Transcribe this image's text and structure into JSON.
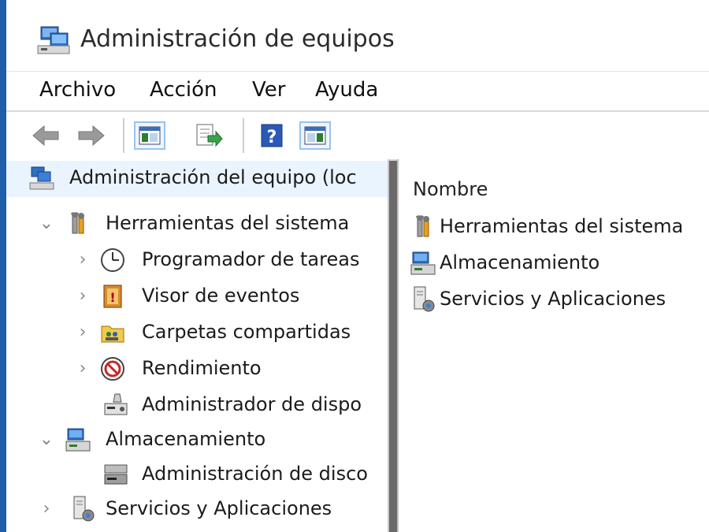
{
  "window": {
    "title": "Administración de equipos"
  },
  "menu": {
    "items": [
      "Archivo",
      "Acción",
      "Ver",
      "Ayuda"
    ]
  },
  "tree": {
    "root": "Administración del equipo (loc",
    "system_tools": "Herramientas del sistema",
    "task_scheduler": "Programador de tareas",
    "event_viewer": "Visor de eventos",
    "shared_folders": "Carpetas compartidas",
    "performance": "Rendimiento",
    "device_manager": "Administrador de dispo",
    "storage": "Almacenamiento",
    "disk_management": "Administración de disco",
    "services_apps": "Servicios y Aplicaciones"
  },
  "list": {
    "column_name": "Nombre",
    "items": [
      "Herramientas del sistema",
      "Almacenamiento",
      "Servicios y Aplicaciones"
    ]
  }
}
